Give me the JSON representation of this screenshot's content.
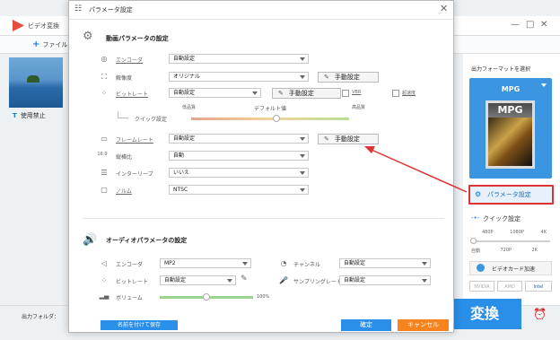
{
  "background_window": {
    "title": "ビデオ変換",
    "add_file": "ファイル",
    "subtitle": "使用禁止",
    "output_folder_label": "出力フォルダ：",
    "convert_button": "変換",
    "controls": {
      "minimize": "—",
      "maximize": "□",
      "close": "✕"
    }
  },
  "right_pane": {
    "output_format_label": "出力フォーマットを選択",
    "format_name": "MPG",
    "format_icon_text": "MPG",
    "params_button": "パラメータ設定",
    "quick_settings_label": "クイック設定",
    "quick_top_ticks": [
      "480P",
      "1080P",
      "4K"
    ],
    "quick_bottom_ticks": [
      "自動",
      "720P",
      "2K"
    ],
    "gpu_button": "ビデオカード加速",
    "chips": [
      "NVIDIA",
      "AMD",
      "Intel"
    ]
  },
  "dialog": {
    "title": "パラメータ設定",
    "close": "✕",
    "video_section": {
      "title": "動画パラメータの設定",
      "rows": [
        {
          "label": "エンコーダ",
          "value": "自動設定",
          "link": true
        },
        {
          "label": "解像度",
          "value": "オリジナル",
          "manual": "手動設定"
        },
        {
          "label": "ビットレート",
          "value": "自動設定",
          "manual": "手動設定",
          "link": true,
          "cb1": "VBR",
          "cb2": "超速度"
        },
        {
          "label": "フレームレート",
          "value": "自動設定",
          "manual": "手動設定",
          "link": true
        },
        {
          "label": "縦横比",
          "value": "自動"
        },
        {
          "label": "インターリーブ",
          "value": "いいえ"
        },
        {
          "label": "ノルム",
          "value": "NTSC",
          "link": true
        }
      ],
      "quality": {
        "low": "低品質",
        "default": "デフォルト値",
        "high": "高品質",
        "label": "クイック設定"
      }
    },
    "audio_section": {
      "title": "オーディオパラメータの設定",
      "encoder": {
        "label": "エンコーダ",
        "value": "MP2"
      },
      "bitrate": {
        "label": "ビットレート",
        "value": "自動設定"
      },
      "volume": {
        "label": "ボリューム",
        "value": "100%"
      },
      "channel": {
        "label": "チャンネル",
        "value": "自動設定"
      },
      "sample_rate": {
        "label": "サンプリングレート",
        "value": "自動設定"
      },
      "volume_level": 0.5
    },
    "buttons": {
      "save_as": "名前を付けて保存",
      "ok": "確定",
      "cancel": "キャンセル"
    }
  },
  "colors": {
    "accent": "#2a8fe8",
    "cancel": "#f5841f",
    "highlight": "#dd3333"
  }
}
